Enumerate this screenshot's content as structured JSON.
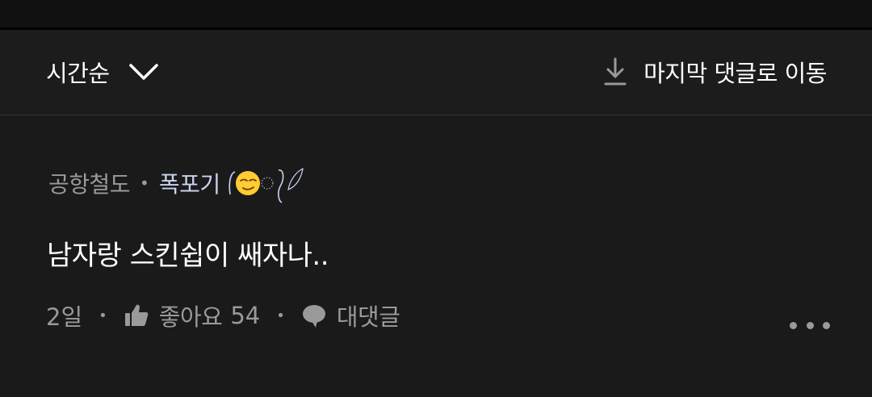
{
  "sort_bar": {
    "sort_label": "시간순",
    "jump_label": "마지막 댓글로 이동"
  },
  "comment": {
    "author": "공항철도",
    "separator": "•",
    "rank_label": "폭포기",
    "rank_emoji": "😏",
    "body": "남자랑 스킨쉽이 쌔자나..",
    "time_ago": "2일",
    "like_label": "좋아요",
    "like_count": "54",
    "reply_label": "대댓글"
  },
  "colors": {
    "background": "#1a1a1a",
    "muted_text": "#9a9a9a",
    "rank_text": "#c9d3f0"
  }
}
